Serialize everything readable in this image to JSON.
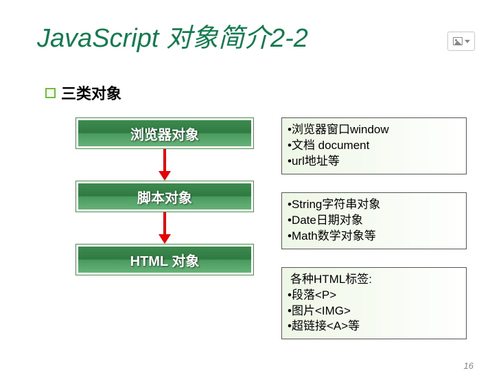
{
  "title_en": "JavaScript",
  "title_cn": "对象简介2-2",
  "subtitle": "三类对象",
  "nodes": [
    "浏览器对象",
    "脚本对象",
    "HTML 对象"
  ],
  "boxes": [
    {
      "intro": null,
      "items": [
        "浏览器窗口window",
        "文档 document",
        "url地址等"
      ]
    },
    {
      "intro": null,
      "items": [
        "String字符串对象",
        "Date日期对象",
        "Math数学对象等"
      ]
    },
    {
      "intro": "各种HTML标签:",
      "items": [
        "段落<P>",
        "图片<IMG>",
        "超链接<A>等"
      ]
    }
  ],
  "pagenum": "16"
}
